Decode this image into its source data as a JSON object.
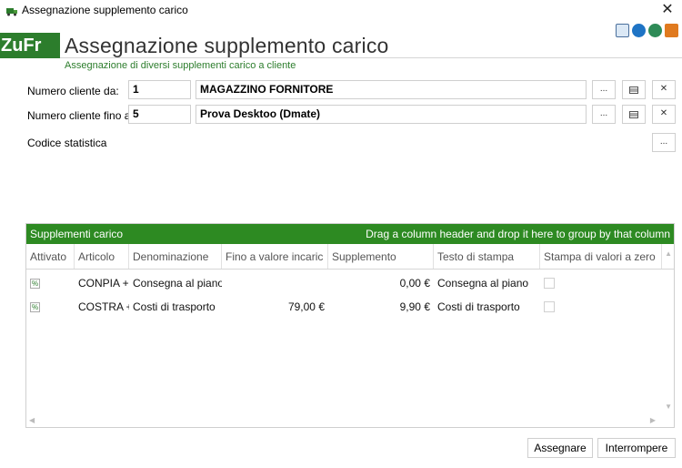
{
  "window": {
    "title": "Assegnazione supplemento carico",
    "close_glyph": "✕"
  },
  "header": {
    "logo": "ZuFr",
    "title": "Assegnazione supplemento carico",
    "subtitle": "Assegnazione di diversi supplementi carico a cliente",
    "top_icons": [
      "mail-icon",
      "swap-icon",
      "user-icon",
      "info-icon"
    ]
  },
  "form": {
    "from": {
      "label": "Numero cliente da:",
      "number": "1",
      "name": "MAGAZZINO FORNITORE"
    },
    "to": {
      "label": "Numero cliente fino a",
      "number": "5",
      "name": "Prova Desktoo (Dmate)"
    },
    "stat": {
      "label": "Codice statistica"
    },
    "browse_label": "...",
    "clear_label": "✕"
  },
  "grid": {
    "title": "Supplementi carico",
    "group_hint": "Drag a column header and drop it here to group by that column",
    "columns": [
      "Attivato",
      "Articolo",
      "Denominazione",
      "Fino a valore incaric",
      "Supplemento",
      "Testo di stampa",
      "Stampa di valori a zero"
    ],
    "rows": [
      {
        "active": "%",
        "article": "CONPIA +",
        "name": "Consegna al piano",
        "limit": "",
        "supplement": "0,00 €",
        "print_text": "Consegna al piano"
      },
      {
        "active": "%",
        "article": "COSTRA +",
        "name": "Costi di trasporto",
        "limit": "79,00 €",
        "supplement": "9,90 €",
        "print_text": "Costi di trasporto"
      }
    ]
  },
  "buttons": {
    "assign": "Assegnare",
    "cancel": "Interrompere"
  },
  "colors": {
    "brand_green": "#2c7d2c",
    "grid_header": "#2d8a22"
  }
}
